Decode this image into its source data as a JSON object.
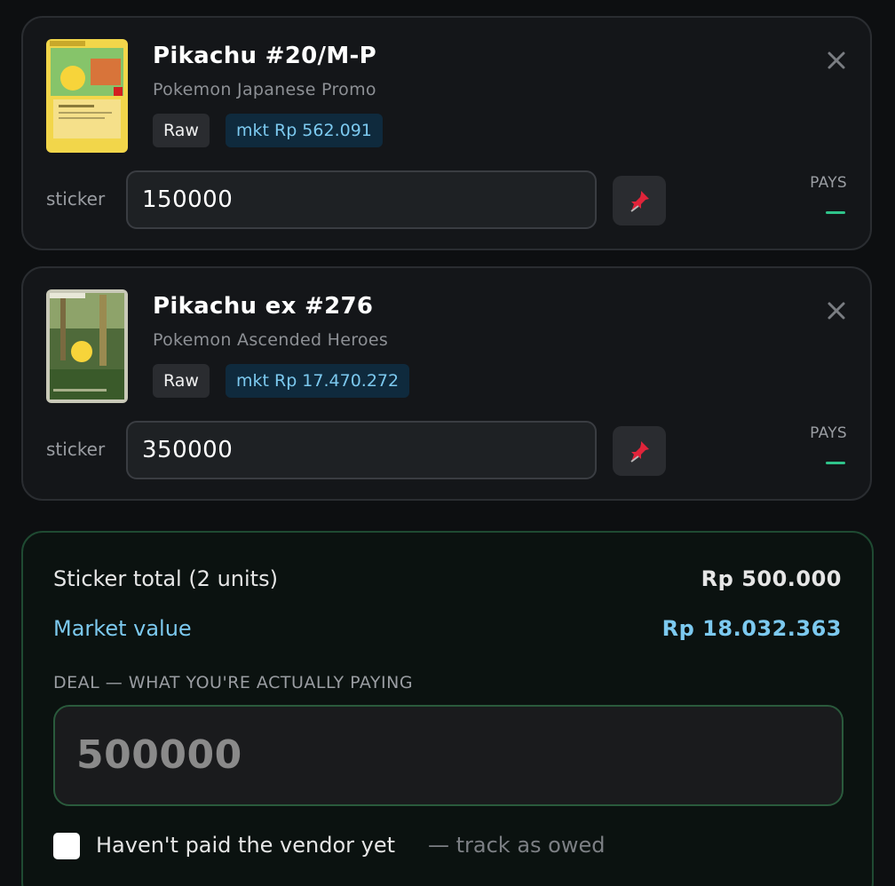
{
  "cards": [
    {
      "title": "Pikachu #20/M-P",
      "subtitle": "Pokemon Japanese Promo",
      "grade_badge": "Raw",
      "market_badge": "mkt Rp 562.091",
      "row_label": "sticker",
      "sticker_value": "150000",
      "pays_label": "PAYS",
      "pays_value": "—"
    },
    {
      "title": "Pikachu ex #276",
      "subtitle": "Pokemon Ascended Heroes",
      "grade_badge": "Raw",
      "market_badge": "mkt Rp 17.470.272",
      "row_label": "sticker",
      "sticker_value": "350000",
      "pays_label": "PAYS",
      "pays_value": "—"
    }
  ],
  "summary": {
    "sticker_total_label": "Sticker total (2 units)",
    "sticker_total_value": "Rp 500.000",
    "market_value_label": "Market value",
    "market_value_value": "Rp 18.032.363",
    "deal_heading": "DEAL — WHAT YOU'RE ACTUALLY PAYING",
    "deal_placeholder": "500000",
    "owed_checkbox_label": "Haven't paid the vendor yet",
    "owed_hint": "— track as owed",
    "owed_checked": false
  },
  "icons": {
    "close": "close-icon",
    "pin": "pushpin-icon",
    "checkbox": "checkbox-icon"
  },
  "colors": {
    "background": "#0d0f11",
    "card_bg": "#141619",
    "accent_blue": "#7cc9ef",
    "accent_green": "#2fc38a",
    "summary_border": "#1f4a32",
    "pin_red": "#e0243a"
  }
}
